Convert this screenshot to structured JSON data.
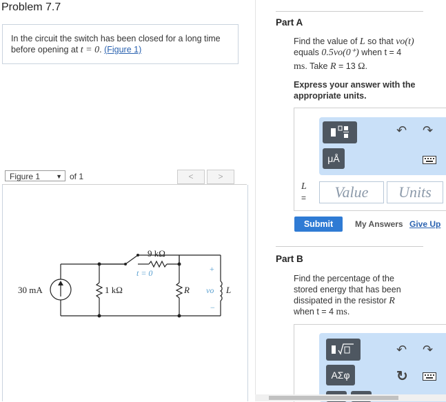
{
  "problem_title": "Problem 7.7",
  "intro": {
    "text_before": "In the circuit the switch has been closed for a long time before opening at ",
    "math": "t = 0",
    "text_after": ". ",
    "figure_link": "(Figure 1)"
  },
  "figure": {
    "select_value": "Figure 1",
    "of_text": "of 1",
    "prev_label": "<",
    "next_label": ">"
  },
  "circuit": {
    "source_label": "30 mA",
    "r1_label": "1 kΩ",
    "r2_label": "9 kΩ",
    "switch_label": "t = 0",
    "r_label": "R",
    "vo_label": "vo",
    "l_label": "L",
    "plus": "+",
    "minus": "−"
  },
  "part_a": {
    "label": "Part A",
    "q1a": "Find the value of ",
    "q1b": "L",
    "q1c": " so that ",
    "q1d": "vo(t)",
    "q2a": "equals ",
    "q2b": "0.5vo(0⁺)",
    "q2c": " when t = 4",
    "q3a": "ms",
    "q3b": ". Take ",
    "q3c": "R",
    "q3d": " = 13 ",
    "q3e": "Ω",
    "q3f": ".",
    "instructions": "Express your answer with the appropriate units.",
    "unit_tool": "μÅ",
    "var_label": "L",
    "eq": "=",
    "value_placeholder": "Value",
    "units_placeholder": "Units",
    "submit_label": "Submit",
    "my_answers_label": "My Answers",
    "give_up_label": "Give Up"
  },
  "part_b": {
    "label": "Part B",
    "q1": "Find the percentage of the",
    "q2": "stored energy that has been",
    "q3a": "dissipated in the resistor ",
    "q3b": "R",
    "q4a": "when t = 4 ",
    "q4b": "ms",
    "q4c": ".",
    "greek_tool": "ΑΣφ"
  }
}
